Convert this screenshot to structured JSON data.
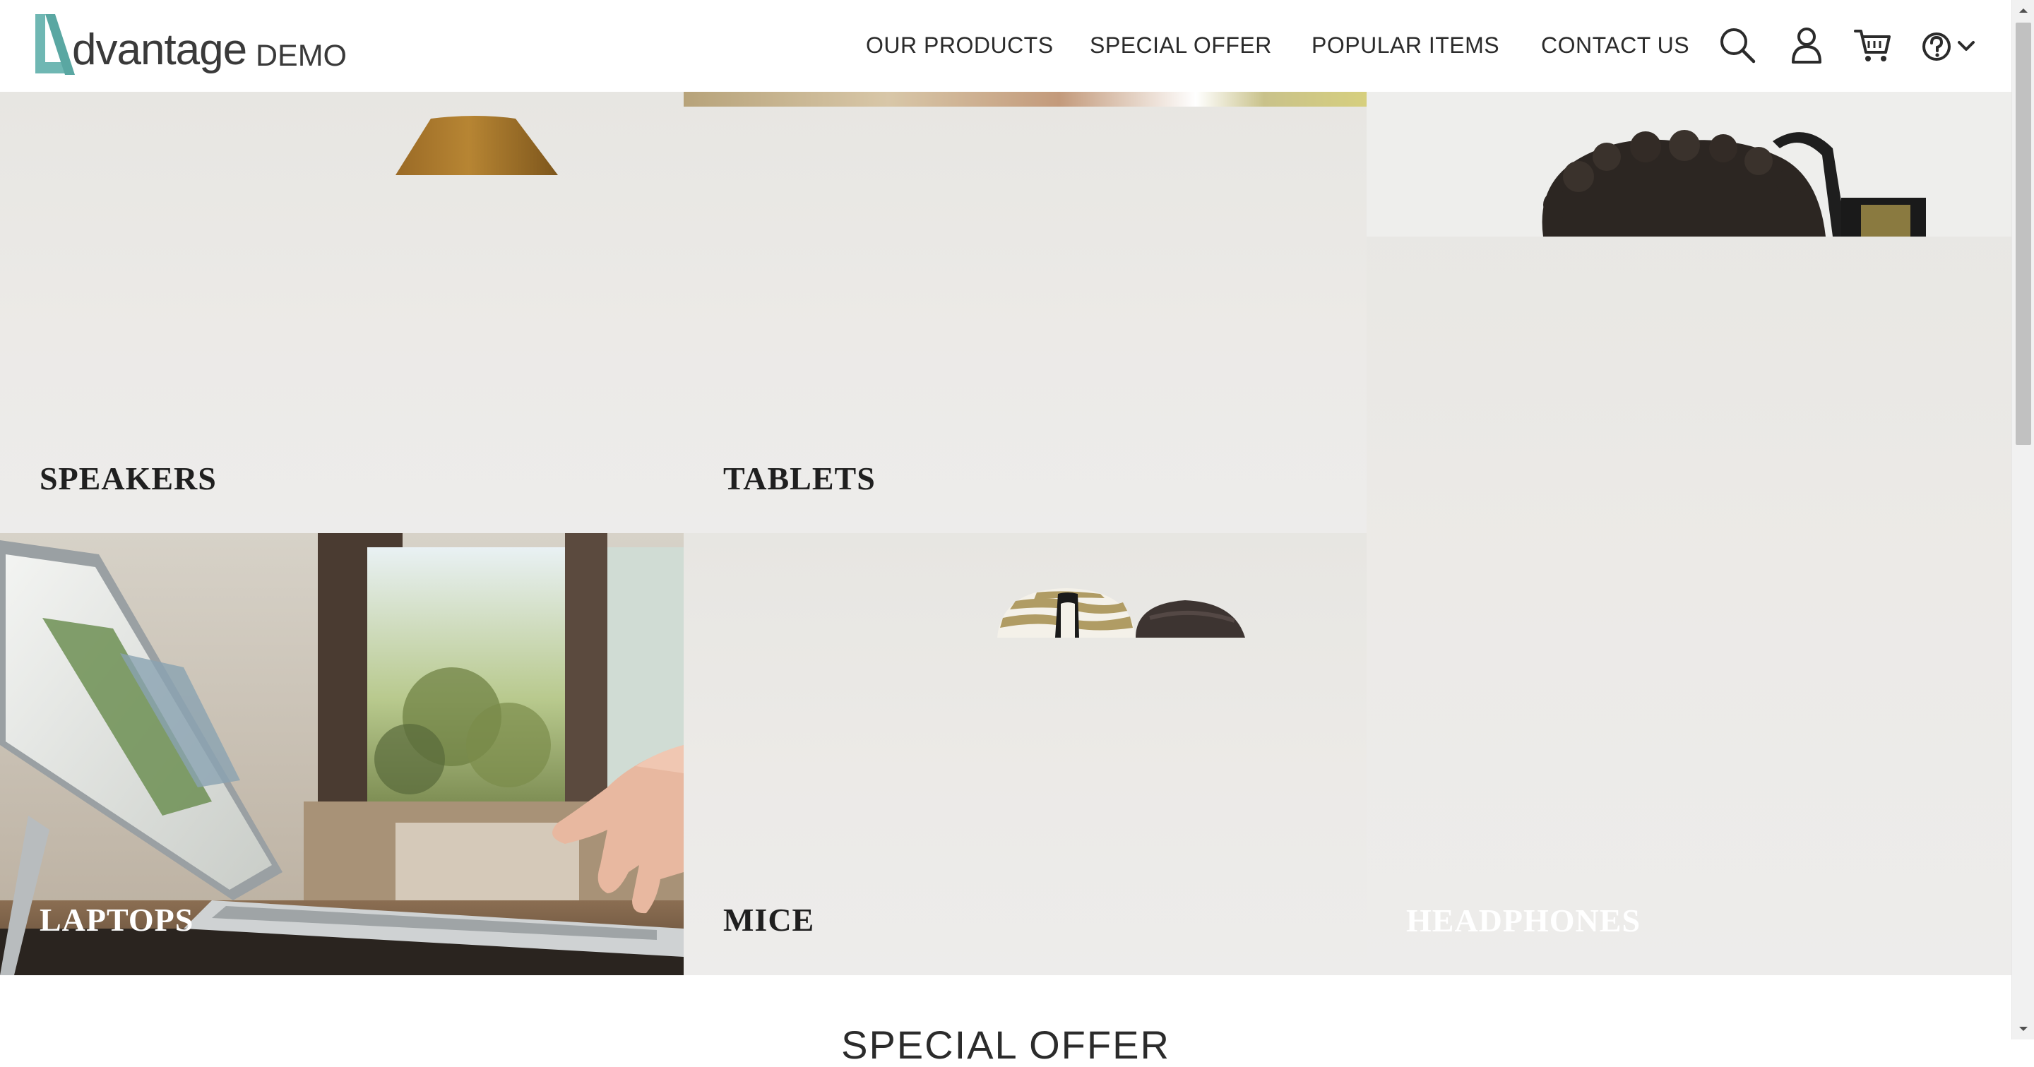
{
  "logo": {
    "word": "dvantage",
    "suffix": "DEMO"
  },
  "nav": {
    "items": [
      {
        "label": "OUR PRODUCTS"
      },
      {
        "label": "SPECIAL OFFER"
      },
      {
        "label": "POPULAR ITEMS"
      },
      {
        "label": "CONTACT US"
      }
    ]
  },
  "header_icons": [
    "search-icon",
    "user-icon",
    "cart-icon",
    "help-icon",
    "chevron-down-icon"
  ],
  "categories": [
    {
      "label": "SPEAKERS"
    },
    {
      "label": "TABLETS"
    },
    {
      "label": "LAPTOPS"
    },
    {
      "label": "MICE"
    },
    {
      "label": "HEADPHONES"
    }
  ],
  "section": {
    "title": "SPECIAL OFFER"
  },
  "colors": {
    "brand_teal": "#6fb7b3",
    "text_dark": "#2b2b2b",
    "tile_bg": "#ebeae6"
  }
}
